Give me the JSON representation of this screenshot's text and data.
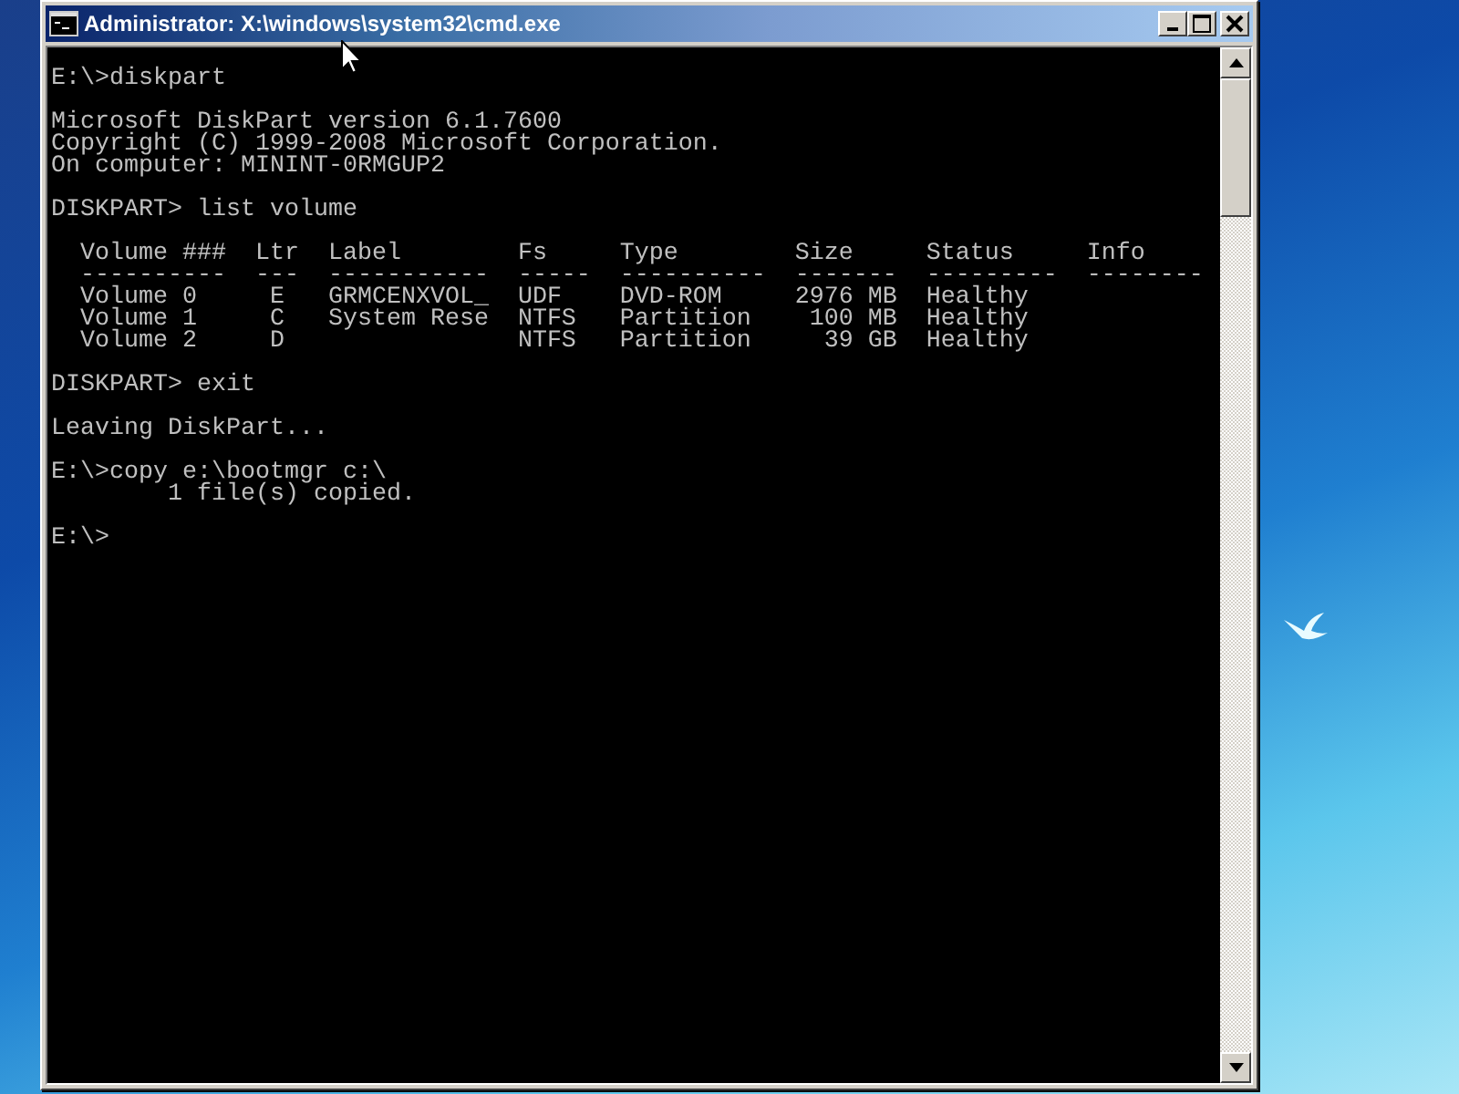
{
  "window": {
    "title": "Administrator: X:\\windows\\system32\\cmd.exe"
  },
  "console": {
    "blocks": [
      [
        "E:\\>diskpart"
      ],
      [
        "Microsoft DiskPart version 6.1.7600",
        "Copyright (C) 1999-2008 Microsoft Corporation.",
        "On computer: MININT-0RMGUP2"
      ],
      [
        "DISKPART> list volume"
      ],
      [
        "  Volume ###  Ltr  Label        Fs     Type        Size     Status     Info",
        "  ----------  ---  -----------  -----  ----------  -------  ---------  --------",
        "  Volume 0     E   GRMCENXVOL_  UDF    DVD-ROM     2976 MB  Healthy",
        "  Volume 1     C   System Rese  NTFS   Partition    100 MB  Healthy",
        "  Volume 2     D                NTFS   Partition     39 GB  Healthy"
      ],
      [
        "DISKPART> exit"
      ],
      [
        "Leaving DiskPart..."
      ],
      [
        "E:\\>copy e:\\bootmgr c:\\",
        "        1 file(s) copied."
      ],
      [
        "E:\\>"
      ]
    ]
  }
}
